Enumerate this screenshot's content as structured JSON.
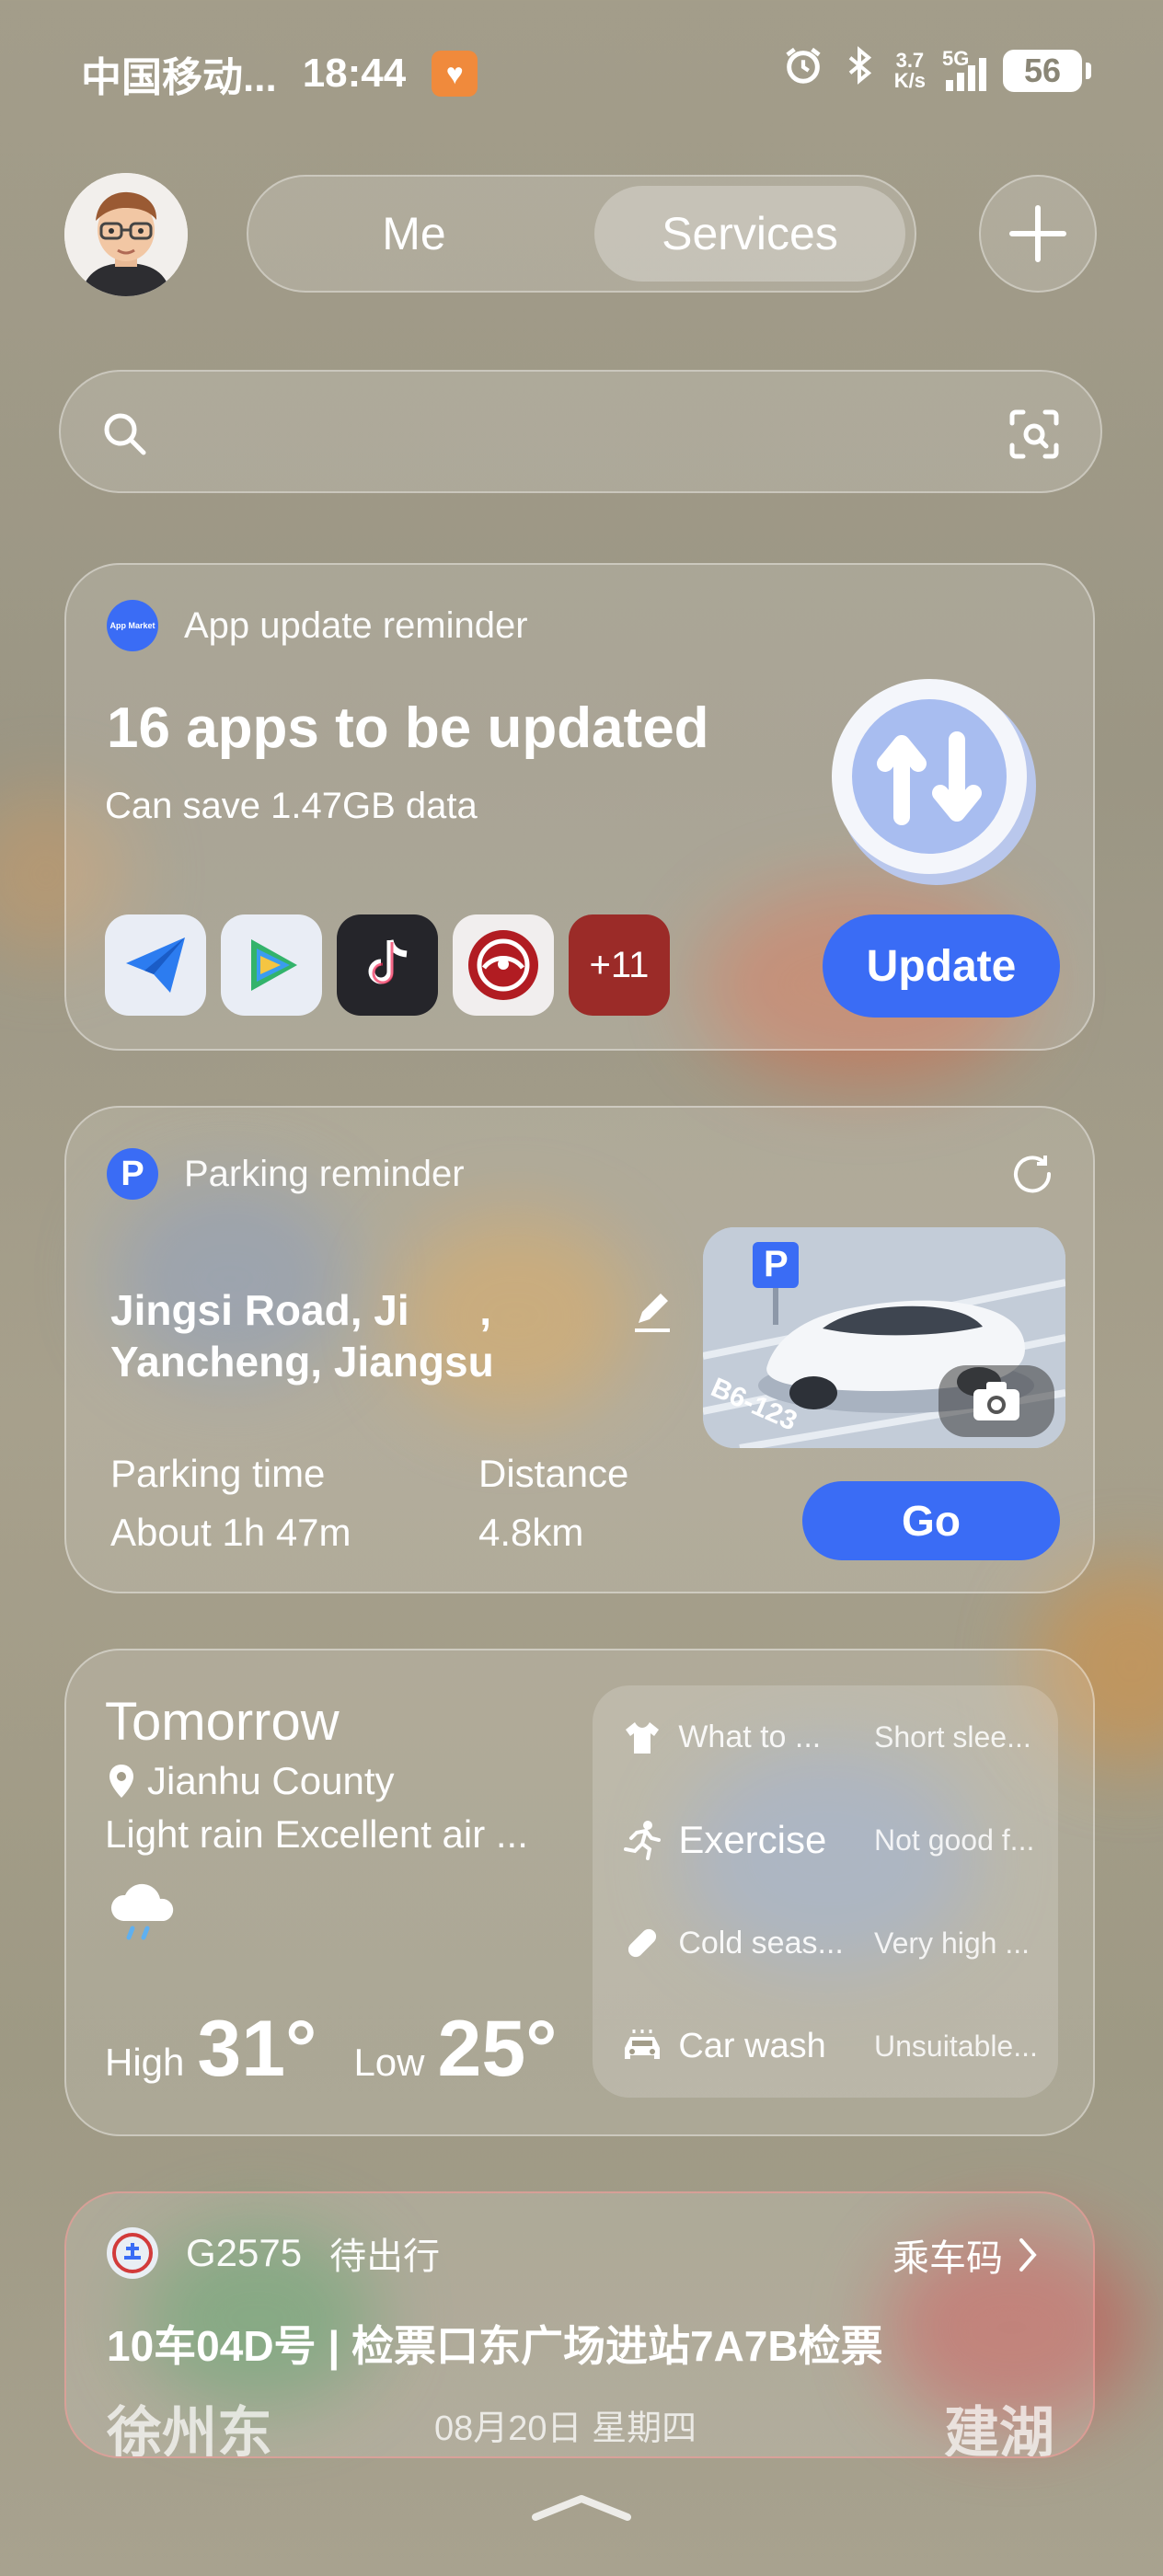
{
  "status_bar": {
    "carrier": "中国移动...",
    "time": "18:44",
    "speed_value": "3.7",
    "speed_unit": "K/s",
    "network": "5G",
    "battery": "56"
  },
  "header": {
    "tab_me": "Me",
    "tab_services": "Services",
    "active_tab": "Services"
  },
  "app_update": {
    "app_icon_label": "App Market",
    "header": "App update reminder",
    "title": "16 apps to be updated",
    "subtitle": "Can save 1.47GB data",
    "more_badge": "+11",
    "button": "Update"
  },
  "parking": {
    "header_icon": "P",
    "header": "Parking reminder",
    "location_line1": "Jingsi Road, Ji      ,",
    "location_line2": "Yancheng, Jiangsu",
    "time_label": "Parking time",
    "time_value": "About 1h 47m",
    "distance_label": "Distance",
    "distance_value": "4.8km",
    "plate": "B6-123",
    "sign": "P",
    "button": "Go"
  },
  "weather": {
    "day": "Tomorrow",
    "location": "Jianhu County",
    "summary": "Light rain Excellent air ...",
    "high_label": "High",
    "high_value": "31°",
    "low_label": "Low",
    "low_value": "25°",
    "rows": [
      {
        "icon": "shirt-icon",
        "label": "What to ...",
        "value": "Short slee..."
      },
      {
        "icon": "running-icon",
        "label": "Exercise",
        "value": "Not good f..."
      },
      {
        "icon": "pill-icon",
        "label": "Cold seas...",
        "value": "Very high ..."
      },
      {
        "icon": "car-icon",
        "label": "Car wash",
        "value": "Unsuitable..."
      }
    ]
  },
  "train": {
    "train_no": "G2575",
    "status": "待出行",
    "ride_code": "乘车码",
    "detail": "10车04D号 | 检票口东广场进站7A7B检票",
    "from": "徐州东",
    "date": "08月20日 星期四",
    "to": "建湖"
  },
  "colors": {
    "accent": "#3a6cf5",
    "background": "#a39d8a"
  }
}
